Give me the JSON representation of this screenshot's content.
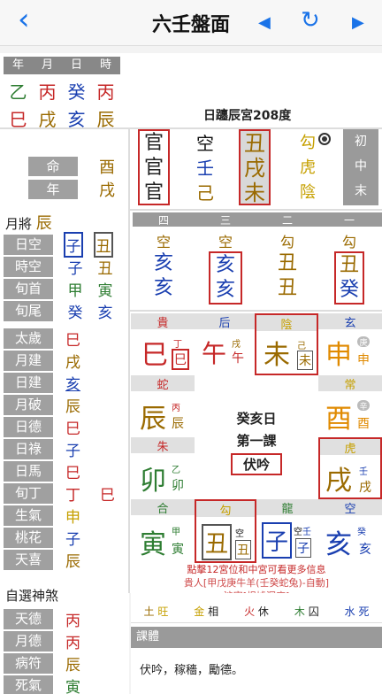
{
  "header": {
    "title": "六壬盤面",
    "back": "‹",
    "prev": "◀",
    "next": "▶",
    "refresh": "↻"
  },
  "pillars": {
    "labels": [
      "年",
      "月",
      "日",
      "時"
    ],
    "stems": [
      "乙",
      "丙",
      "癸",
      "丙"
    ],
    "branches": [
      "巳",
      "戌",
      "亥",
      "辰"
    ]
  },
  "info": {
    "text": "日躔辰宮208度"
  },
  "minggong": [
    {
      "label": "命",
      "value": "酉"
    },
    {
      "label": "年",
      "value": "戌"
    }
  ],
  "yuejiang": {
    "label": "月將",
    "value": "辰"
  },
  "leftpairs": [
    {
      "label": "日空",
      "a": "子",
      "b": "丑"
    },
    {
      "label": "時空",
      "a": "子",
      "b": "丑"
    },
    {
      "label": "旬首",
      "a": "甲",
      "b": "寅"
    },
    {
      "label": "旬尾",
      "a": "癸",
      "b": "亥"
    }
  ],
  "shensha": [
    {
      "label": "太歲",
      "value": "巳"
    },
    {
      "label": "月建",
      "value": "戌"
    },
    {
      "label": "日建",
      "value": "亥"
    },
    {
      "label": "月破",
      "value": "辰"
    },
    {
      "label": "日德",
      "value": "巳"
    },
    {
      "label": "日祿",
      "value": "子"
    },
    {
      "label": "日馬",
      "value": "巳"
    },
    {
      "label": "旬丁",
      "value": "丁",
      "extra": "巳"
    },
    {
      "label": "生氣",
      "value": "申"
    },
    {
      "label": "桃花",
      "value": "子"
    },
    {
      "label": "天喜",
      "value": "辰"
    }
  ],
  "zixuan": {
    "title": "自選神煞",
    "items": [
      {
        "label": "天德",
        "value": "丙"
      },
      {
        "label": "月德",
        "value": "丙"
      },
      {
        "label": "病符",
        "value": "辰"
      },
      {
        "label": "死氣",
        "value": "寅"
      }
    ]
  },
  "sanchuan": {
    "cols": [
      {
        "r1": "官",
        "r2": "官",
        "r3": "官"
      },
      {
        "r1": "空",
        "r2": "壬",
        "r3": "己"
      },
      {
        "r1": "丑",
        "r2": "戌",
        "r3": "未"
      },
      {
        "r1": "勾",
        "r2": "虎",
        "r3": "陰"
      }
    ],
    "tags": [
      "初",
      "中",
      "末"
    ]
  },
  "sike": {
    "heads": [
      "四",
      "三",
      "二",
      "一"
    ],
    "cols": [
      {
        "g": "空",
        "a": "亥",
        "b": "亥"
      },
      {
        "g": "空",
        "a": "亥",
        "b": "亥"
      },
      {
        "g": "勾",
        "a": "丑",
        "b": "丑"
      },
      {
        "g": "勾",
        "a": "丑",
        "b": "癸"
      }
    ]
  },
  "grid": {
    "top": [
      {
        "god": "貴",
        "br": "巳",
        "s1": "丁",
        "s2": "丁",
        "s3": "巳"
      },
      {
        "god": "后",
        "br": "午",
        "s1": "戊",
        "s2": "戌",
        "s3": "午"
      },
      {
        "god": "陰",
        "br": "未",
        "s1": "己",
        "s2": "己",
        "s3": "未"
      },
      {
        "god": "玄",
        "br": "申",
        "s1": "庚",
        "s2": "",
        "s3": "申"
      }
    ],
    "left": [
      {
        "god": "蛇",
        "br": "辰",
        "s1": "丙",
        "s2": "丙",
        "s3": "辰"
      },
      {
        "god": "朱",
        "br": "卯",
        "s1": "乙",
        "s2": "乙",
        "s3": "卯"
      }
    ],
    "right": [
      {
        "god": "常",
        "br": "酉",
        "s1": "辛",
        "s2": "",
        "s3": "酉"
      },
      {
        "god": "虎",
        "br": "戌",
        "s1": "壬",
        "s2": "壬",
        "s3": "戌"
      }
    ],
    "bottom": [
      {
        "god": "合",
        "br": "寅",
        "s1": "甲",
        "s2": "甲",
        "s3": "寅"
      },
      {
        "god": "勾",
        "br": "丑",
        "s1": "空",
        "s2": "",
        "s3": "丑"
      },
      {
        "god": "龍",
        "br": "子",
        "s1": "空",
        "s2": "壬",
        "s3": "子"
      },
      {
        "god": "空",
        "br": "亥",
        "s1": "癸",
        "s2": "癸",
        "s3": "亥"
      }
    ],
    "center": {
      "l1": "癸亥日",
      "l2": "第一課",
      "l3": "伏吟"
    }
  },
  "notes": {
    "n1": "點擊12宮位和中宮可看更多信息",
    "n2": "貴人[甲戊庚牛羊(壬癸蛇兔)-自動]",
    "n3": "涉害[根據深度]"
  },
  "wuxing": [
    {
      "e": "土",
      "s": "旺",
      "c": "#9a6a00"
    },
    {
      "e": "金",
      "s": "相",
      "c": "#c6a000"
    },
    {
      "e": "火",
      "s": "休",
      "c": "#c62828"
    },
    {
      "e": "木",
      "s": "囚",
      "c": "#2e7d32"
    },
    {
      "e": "水",
      "s": "死",
      "c": "#1a3fb0"
    }
  ],
  "keti": {
    "label": "課體",
    "text": "伏吟，稼穡，勵德。"
  }
}
